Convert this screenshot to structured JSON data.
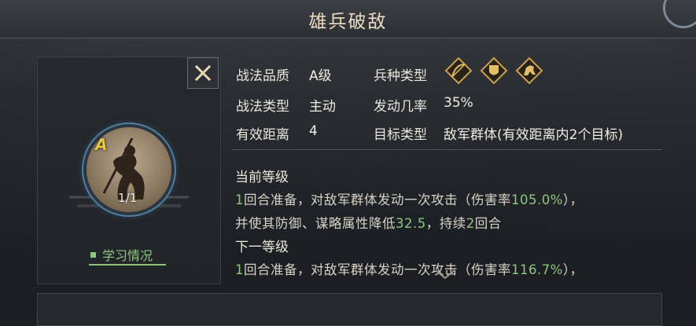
{
  "header": {
    "title": "雄兵破敌"
  },
  "close_label": "✕",
  "portrait": {
    "grade": "A",
    "progress": "1/1"
  },
  "study": {
    "label": "学习情况"
  },
  "info": {
    "quality_label": "战法品质",
    "quality_value": "A级",
    "type_label": "战法类型",
    "type_value": "主动",
    "range_label": "有效距离",
    "range_value": "4",
    "troop_label": "兵种类型",
    "rate_label": "发动几率",
    "rate_value": "35%",
    "target_label": "目标类型",
    "target_value": "敌军群体(有效距离内2个目标)"
  },
  "troop_icons": [
    "archer-crest-icon",
    "shield-crest-icon",
    "cavalry-crest-icon"
  ],
  "current_level": {
    "title": "当前等级",
    "line1_num": "1",
    "line1_a": "回合准备，对敌军群体发动一次攻击（伤害率",
    "line1_pct": "105.0%",
    "line1_b": "），",
    "line2_a": "并使其防御、谋略属性降低",
    "line2_num1": "32.5",
    "line2_b": "，持续",
    "line2_num2": "2",
    "line2_c": "回合"
  },
  "next_level": {
    "title": "下一等级",
    "line1_num": "1",
    "line1_a": "回合准备，对敌军群体发动一次攻击（伤害率",
    "line1_pct": "116.7%",
    "line1_b": "），"
  },
  "colors": {
    "highlight": "#8fc682",
    "gold": "#e8c64a",
    "title": "#e9dcc3"
  }
}
